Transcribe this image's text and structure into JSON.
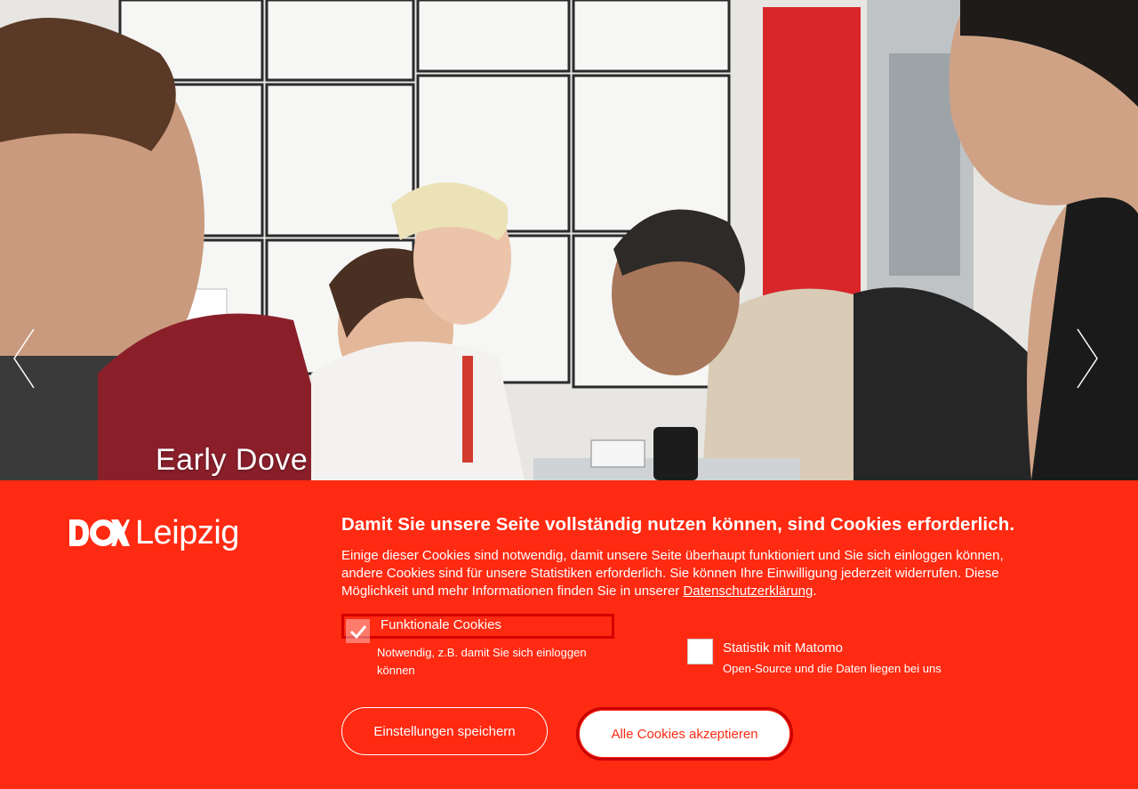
{
  "hero": {
    "caption": "Early Dove",
    "prev_icon": "chevron-left-icon",
    "next_icon": "chevron-right-icon"
  },
  "brand": {
    "logo_text": "Leipzig",
    "logo_mark": "DOK",
    "accent": "#ff2a12",
    "focus": "#d40000"
  },
  "cookie": {
    "title": "Damit Sie unsere Seite vollständig nutzen können, sind Cookies erforderlich.",
    "description": "Einige dieser Cookies sind notwendig, damit unsere Seite überhaupt funktioniert und Sie sich einloggen können, andere Cookies sind für unsere Statistiken erforderlich. Sie können Ihre Einwilligung jederzeit widerrufen. Diese Möglichkeit und mehr Informationen finden Sie in unserer",
    "privacy_link": "Datenschutzerklärung",
    "options": [
      {
        "label": "Funktionale Cookies",
        "sub": "Notwendig, z.B. damit Sie sich einloggen können",
        "checked": true,
        "disabled": true
      },
      {
        "label": "Statistik mit Matomo",
        "sub": "Open-Source und die Daten liegen bei uns",
        "checked": false,
        "disabled": false
      }
    ],
    "save_label": "Einstellungen speichern",
    "accept_label": "Alle Cookies akzeptieren"
  }
}
